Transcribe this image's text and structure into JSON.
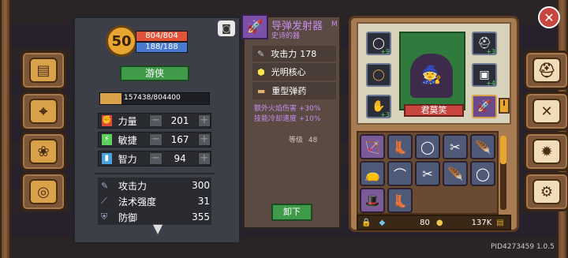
{
  "hero": {
    "level": "50",
    "hp": "804/804",
    "mp": "188/188",
    "class_name": "游侠",
    "exp": "157438/804400",
    "exp_fraction": 0.196,
    "attributes": [
      {
        "label": "力量",
        "value": "201",
        "icon": "strength-icon"
      },
      {
        "label": "敏捷",
        "value": "167",
        "icon": "agility-icon"
      },
      {
        "label": "智力",
        "value": "94",
        "icon": "intellect-icon"
      }
    ],
    "derived": [
      {
        "label": "攻击力",
        "value": "300",
        "icon": "sword-icon"
      },
      {
        "label": "法术强度",
        "value": "31",
        "icon": "wand-icon"
      },
      {
        "label": "防御",
        "value": "355",
        "icon": "shield-icon"
      }
    ]
  },
  "item": {
    "name": "导弹发射器",
    "tier": "M",
    "rarity": "史诗的器",
    "attack_label": "攻击力",
    "attack_value": "178",
    "gems": [
      "光明核心",
      "重型弹药"
    ],
    "bonuses": [
      "额外火焰伤害 +30%",
      "技能冷却速度 +10%"
    ],
    "level_label": "等级",
    "level_value": "48",
    "unequip_label": "卸下"
  },
  "character": {
    "name": "君莫笑"
  },
  "equip_slots": [
    {
      "name": "ring-slot",
      "badge": "+9"
    },
    {
      "name": "helmet-slot",
      "badge": "+3"
    },
    {
      "name": "amulet-slot",
      "badge": ""
    },
    {
      "name": "armor-slot",
      "badge": "+4"
    },
    {
      "name": "boots-slot",
      "badge": "+3"
    }
  ],
  "inventory": {
    "diamonds": "80",
    "gold": "137K"
  },
  "footer": {
    "pid": "PID4273459 1.0.5"
  },
  "colors": {
    "hp": "#e0543a",
    "mp": "#4a7ad0",
    "accent": "#d9a24a",
    "button_green": "#3f9a4a"
  }
}
